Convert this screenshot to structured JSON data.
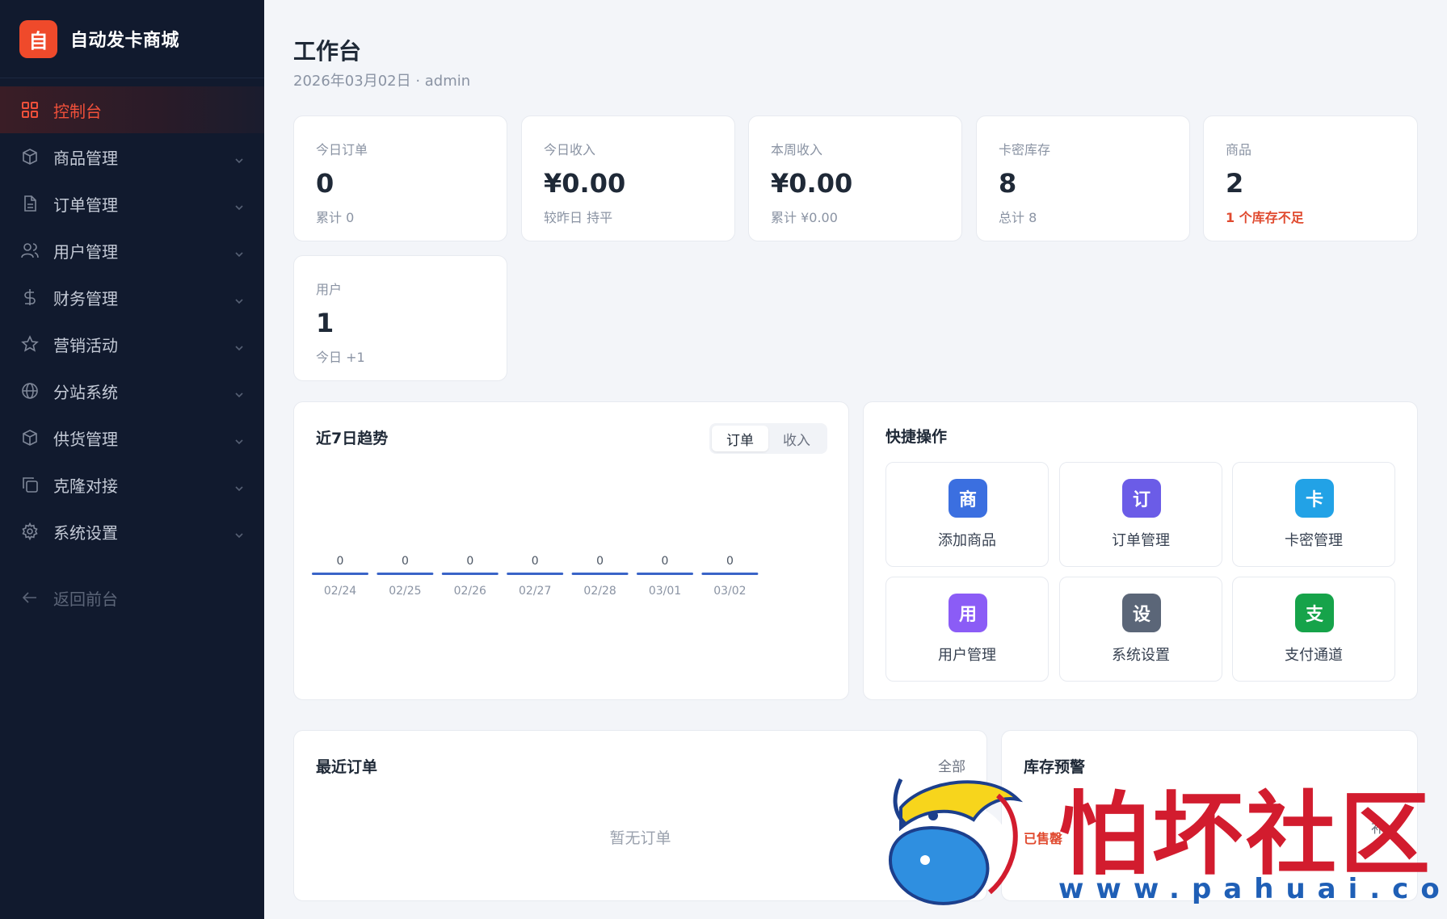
{
  "brand": {
    "logo_char": "自",
    "name": "自动发卡商城"
  },
  "sidebar": {
    "items": [
      {
        "label": "控制台",
        "icon": "grid-icon"
      },
      {
        "label": "商品管理",
        "icon": "box-icon"
      },
      {
        "label": "订单管理",
        "icon": "file-icon"
      },
      {
        "label": "用户管理",
        "icon": "users-icon"
      },
      {
        "label": "财务管理",
        "icon": "dollar-icon"
      },
      {
        "label": "营销活动",
        "icon": "star-icon"
      },
      {
        "label": "分站系统",
        "icon": "globe-icon"
      },
      {
        "label": "供货管理",
        "icon": "box-icon"
      },
      {
        "label": "克隆对接",
        "icon": "copy-icon"
      },
      {
        "label": "系统设置",
        "icon": "gear-icon"
      }
    ],
    "back_label": "返回前台"
  },
  "header": {
    "title": "工作台",
    "subtitle": "2026年03月02日 · admin"
  },
  "stats": [
    {
      "label": "今日订单",
      "value": "0",
      "note": "累计 0"
    },
    {
      "label": "今日收入",
      "value": "¥0.00",
      "note": "较昨日 持平"
    },
    {
      "label": "本周收入",
      "value": "¥0.00",
      "note": "累计 ¥0.00"
    },
    {
      "label": "卡密库存",
      "value": "8",
      "note": "总计 8"
    },
    {
      "label": "商品",
      "value": "2",
      "note": "1 个库存不足"
    },
    {
      "label": "用户",
      "value": "1",
      "note": "今日 +1"
    }
  ],
  "trend": {
    "title": "近7日趋势",
    "tabs": [
      "订单",
      "收入"
    ],
    "active_tab": "订单"
  },
  "chart_data": {
    "type": "bar",
    "title": "近7日趋势",
    "categories": [
      "02/24",
      "02/25",
      "02/26",
      "02/27",
      "02/28",
      "03/01",
      "03/02"
    ],
    "values": [
      0,
      0,
      0,
      0,
      0,
      0,
      0
    ],
    "bar_color": "#3a64c8"
  },
  "quick": {
    "title": "快捷操作",
    "items": [
      {
        "char": "商",
        "label": "添加商品",
        "color": "#3b6fe0"
      },
      {
        "char": "订",
        "label": "订单管理",
        "color": "#6b5ce7"
      },
      {
        "char": "卡",
        "label": "卡密管理",
        "color": "#22a2e6"
      },
      {
        "char": "用",
        "label": "用户管理",
        "color": "#8b5cf6"
      },
      {
        "char": "设",
        "label": "系统设置",
        "color": "#5b6678"
      },
      {
        "char": "支",
        "label": "支付通道",
        "color": "#16a34a"
      }
    ]
  },
  "recent_orders": {
    "title": "最近订单",
    "link": "全部",
    "empty": "暂无订单"
  },
  "stock_alert": {
    "title": "库存预警",
    "badge": "已售罄",
    "link": "补"
  },
  "watermark": {
    "text": "怕坏社区",
    "url": "www.pahuai.com"
  },
  "colors": {
    "accent": "#f1503a",
    "sidebar_bg": "#111a2e",
    "warn": "#e04a2f"
  }
}
